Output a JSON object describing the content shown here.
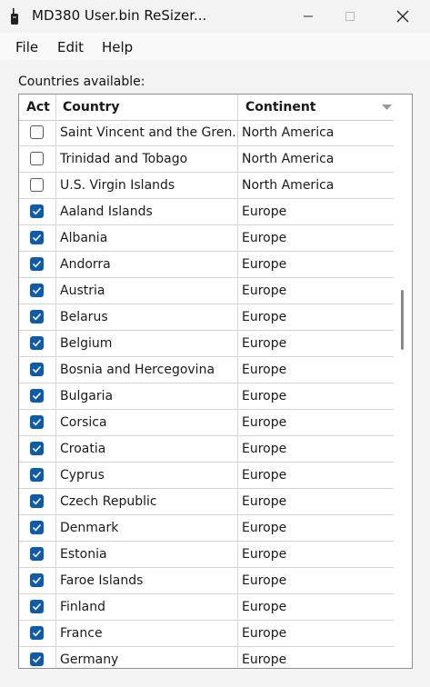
{
  "window": {
    "title": "MD380 User.bin ReSizer..."
  },
  "menu": {
    "file": "File",
    "edit": "Edit",
    "help": "Help"
  },
  "countries_label": "Countries available:",
  "table": {
    "columns": {
      "act": "Act",
      "country": "Country",
      "continent": "Continent"
    },
    "rows": [
      {
        "checked": false,
        "country": "Saint Vincent and the Gren...",
        "continent": "North America"
      },
      {
        "checked": false,
        "country": "Trinidad and Tobago",
        "continent": "North America"
      },
      {
        "checked": false,
        "country": "U.S. Virgin Islands",
        "continent": "North America"
      },
      {
        "checked": true,
        "country": "Aaland Islands",
        "continent": "Europe"
      },
      {
        "checked": true,
        "country": "Albania",
        "continent": "Europe"
      },
      {
        "checked": true,
        "country": "Andorra",
        "continent": "Europe"
      },
      {
        "checked": true,
        "country": "Austria",
        "continent": "Europe"
      },
      {
        "checked": true,
        "country": "Belarus",
        "continent": "Europe"
      },
      {
        "checked": true,
        "country": "Belgium",
        "continent": "Europe"
      },
      {
        "checked": true,
        "country": "Bosnia and Hercegovina",
        "continent": "Europe"
      },
      {
        "checked": true,
        "country": "Bulgaria",
        "continent": "Europe"
      },
      {
        "checked": true,
        "country": "Corsica",
        "continent": "Europe"
      },
      {
        "checked": true,
        "country": "Croatia",
        "continent": "Europe"
      },
      {
        "checked": true,
        "country": "Cyprus",
        "continent": "Europe"
      },
      {
        "checked": true,
        "country": "Czech Republic",
        "continent": "Europe"
      },
      {
        "checked": true,
        "country": "Denmark",
        "continent": "Europe"
      },
      {
        "checked": true,
        "country": "Estonia",
        "continent": "Europe"
      },
      {
        "checked": true,
        "country": "Faroe Islands",
        "continent": "Europe"
      },
      {
        "checked": true,
        "country": "Finland",
        "continent": "Europe"
      },
      {
        "checked": true,
        "country": "France",
        "continent": "Europe"
      },
      {
        "checked": true,
        "country": "Germany",
        "continent": "Europe"
      }
    ]
  },
  "colors": {
    "checkbox_checked": "#0b5cad",
    "border": "#8e8e8e",
    "gridline": "#d6d6d6"
  }
}
